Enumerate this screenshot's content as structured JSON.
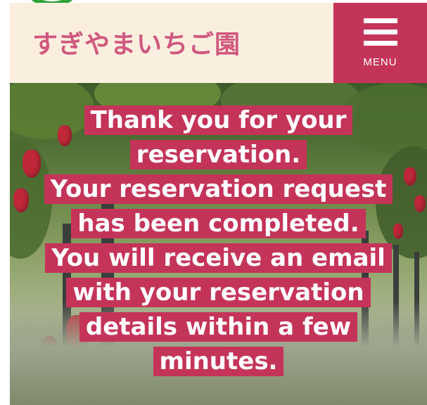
{
  "header": {
    "logo_text": "すぎやまいちご園",
    "menu_label": "MENU",
    "menu_icon": "hamburger-icon",
    "colors": {
      "header_bg": "#faefdf",
      "logo": "#d0587e",
      "menu_bg": "#c43459"
    }
  },
  "message": {
    "lines": [
      "Thank you for your",
      "reservation.",
      "Your reservation request",
      "has been completed.",
      "You will receive an email",
      "with your reservation",
      "details within a few",
      "minutes."
    ],
    "colors": {
      "highlight_bg": "#c43459",
      "text": "#ffffff"
    }
  }
}
